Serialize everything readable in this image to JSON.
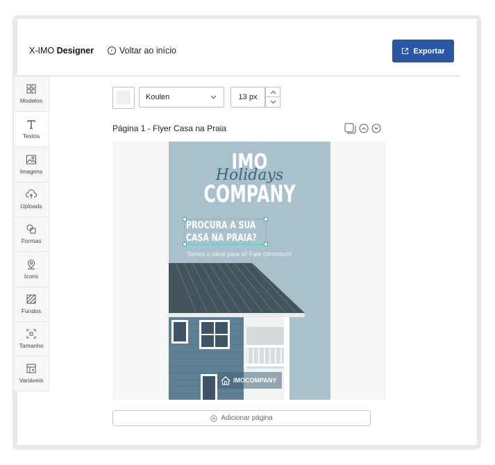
{
  "header": {
    "brand_prefix": "X-IMO",
    "brand_bold": "Designer",
    "back_label": "Voltar ao início",
    "export_label": "Exportar"
  },
  "sidebar": {
    "items": [
      {
        "label": "Modelos",
        "icon": "grid-icon"
      },
      {
        "label": "Textos",
        "icon": "text-icon"
      },
      {
        "label": "Imagens",
        "icon": "image-icon"
      },
      {
        "label": "Uploads",
        "icon": "upload-cloud-icon"
      },
      {
        "label": "Formas",
        "icon": "shapes-icon"
      },
      {
        "label": "Icons",
        "icon": "pin-icon"
      },
      {
        "label": "Fundos",
        "icon": "hatch-icon"
      },
      {
        "label": "Tamanho",
        "icon": "resize-icon"
      },
      {
        "label": "Variáveis",
        "icon": "variables-icon"
      }
    ],
    "active": "Textos"
  },
  "toolbar": {
    "font_value": "Koulen",
    "size_value": "13 px"
  },
  "page": {
    "title": "Página 1 - Flyer Casa na Praia"
  },
  "flyer": {
    "imo": "IMO",
    "script": "Holidays",
    "company": "COMPANY",
    "headline_1": "PROCURA A SUA",
    "headline_2": "CASA NA PRAIA?",
    "subline": "Temos o ideal para si! Fale connosco!",
    "logo_text": "IMOCOMPANY"
  },
  "add_page_label": "Adicionar página",
  "colors": {
    "accent": "#2a56a4",
    "flyer_sky": "#a9c1cd",
    "selection": "#4fd0c8"
  }
}
